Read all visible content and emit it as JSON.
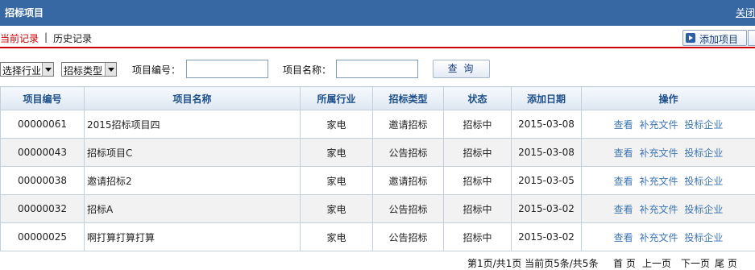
{
  "header": {
    "title": "招标项目",
    "close_label": "关闭"
  },
  "tabs": {
    "current": "当前记录",
    "separator": "|",
    "history": "历史记录"
  },
  "toolbar": {
    "add_label": "添加项目"
  },
  "filters": {
    "industry_select": "选择行业",
    "type_select": "招标类型",
    "code_label": "项目编号：",
    "code_value": "",
    "name_label": "项目名称：",
    "name_value": "",
    "query_label": "查 询"
  },
  "table": {
    "columns": [
      "项目编号",
      "项目名称",
      "所属行业",
      "招标类型",
      "状态",
      "添加日期",
      "操作"
    ],
    "rows": [
      {
        "code": "00000061",
        "name": "2015招标项目四",
        "industry": "家电",
        "type": "邀请招标",
        "status": "招标中",
        "date": "2015-03-08"
      },
      {
        "code": "00000043",
        "name": "招标项目C",
        "industry": "家电",
        "type": "公告招标",
        "status": "招标中",
        "date": "2015-03-08"
      },
      {
        "code": "00000038",
        "name": "邀请招标2",
        "industry": "家电",
        "type": "邀请招标",
        "status": "招标中",
        "date": "2015-03-05"
      },
      {
        "code": "00000032",
        "name": "招标A",
        "industry": "家电",
        "type": "公告招标",
        "status": "招标中",
        "date": "2015-03-02"
      },
      {
        "code": "00000025",
        "name": "啊打算打算打算",
        "industry": "家电",
        "type": "公告招标",
        "status": "招标中",
        "date": "2015-03-02"
      }
    ],
    "actions": {
      "view": "查看",
      "supplement": "补充文件",
      "bidders": "投标企业"
    }
  },
  "pager": {
    "info": "第1页/共1页 当前页5条/共5条",
    "first": "首 页",
    "prev": "上一页",
    "next": "下一页",
    "last": "尾 页"
  },
  "colors": {
    "header_bg": "#3768a4",
    "accent_red": "#cc0000",
    "link_blue": "#3d75b3"
  }
}
